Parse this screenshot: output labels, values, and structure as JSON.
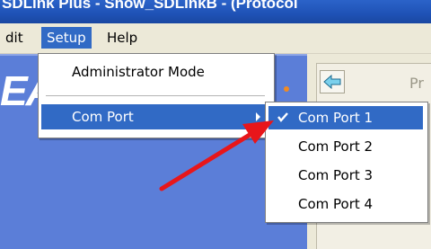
{
  "window": {
    "title": "SDLink Plus - Show_SDLinkB - (Protocol"
  },
  "menubar": {
    "items": [
      {
        "label": "dit"
      },
      {
        "label": "Setup"
      },
      {
        "label": "Help"
      }
    ]
  },
  "background": {
    "banner_text": "EA",
    "right_label": "Pr"
  },
  "setup_menu": {
    "items": [
      {
        "label": "Administrator Mode"
      },
      {
        "label": "Com Port"
      }
    ]
  },
  "comport_menu": {
    "items": [
      {
        "label": "Com Port 1",
        "checked": true
      },
      {
        "label": "Com Port 2",
        "checked": false
      },
      {
        "label": "Com Port 3",
        "checked": false
      },
      {
        "label": "Com Port 4",
        "checked": false
      }
    ]
  },
  "colors": {
    "highlight": "#316ac5",
    "annotation_arrow": "#e8161a",
    "titlebar": "#1f52b6"
  }
}
